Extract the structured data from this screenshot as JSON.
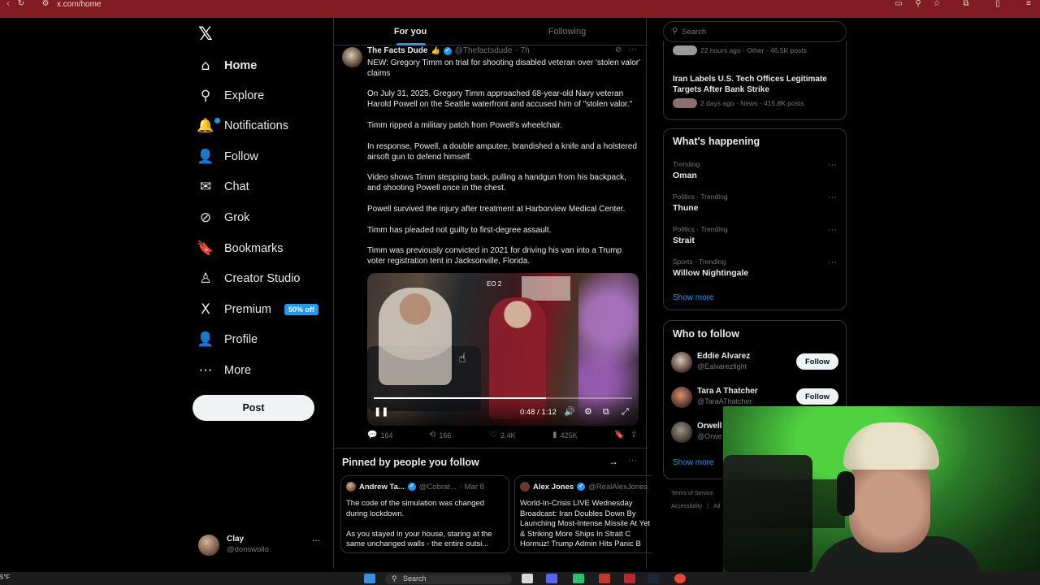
{
  "browser": {
    "url": "x.com/home",
    "accent": "#7f1d22"
  },
  "nav": {
    "items": [
      {
        "label": "Home",
        "icon": "home-icon",
        "glyph": "⌂"
      },
      {
        "label": "Explore",
        "icon": "search-icon",
        "glyph": "⚲"
      },
      {
        "label": "Notifications",
        "icon": "bell-icon",
        "glyph": "🔔"
      },
      {
        "label": "Follow",
        "icon": "follow-icon",
        "glyph": "👤"
      },
      {
        "label": "Chat",
        "icon": "mail-icon",
        "glyph": "✉"
      },
      {
        "label": "Grok",
        "icon": "grok-icon",
        "glyph": "⊘"
      },
      {
        "label": "Bookmarks",
        "icon": "bookmark-icon",
        "glyph": "🔖"
      },
      {
        "label": "Creator Studio",
        "icon": "creator-icon",
        "glyph": "♙"
      },
      {
        "label": "Premium",
        "icon": "x-icon",
        "glyph": "X"
      },
      {
        "label": "Profile",
        "icon": "profile-icon",
        "glyph": "👤"
      },
      {
        "label": "More",
        "icon": "more-icon",
        "glyph": "⋯"
      }
    ],
    "premium_badge": "50% off",
    "post_label": "Post",
    "account": {
      "name": "Clay",
      "handle": "@donswollo",
      "more": "···"
    }
  },
  "feed": {
    "tabs": [
      {
        "label": "For you"
      },
      {
        "label": "Following"
      }
    ],
    "tweet": {
      "author": "The Facts Dude",
      "handle": "@Thefactsdude",
      "time": "· 7h",
      "paragraphs": [
        "NEW: Gregory Timm on trial for shooting disabled veteran over 'stolen valor' claims",
        "On July 31, 2025, Gregory Timm approached 68-year-old Navy veteran Harold Powell on the Seattle waterfront and accused him of \"stolen valor.\"",
        "Timm ripped a military patch from Powell's wheelchair.",
        "In response, Powell, a double amputee, brandished a knife and a holstered airsoft gun to defend himself.",
        "Video shows Timm stepping back, pulling a handgun from his backpack, and shooting Powell once in the chest.",
        "Powell survived the injury after treatment at Harborview Medical Center.",
        "Timm has pleaded not guilty to first-degree assault.",
        "Timm was previously convicted in 2021 for driving his van into a Trump voter registration tent in Jacksonville, Florida."
      ],
      "video": {
        "label": "EO 2",
        "time": "0:48 / 1:12",
        "progress": 0.667
      },
      "stats": {
        "replies": "164",
        "reposts": "166",
        "likes": "2.4K",
        "views": "425K"
      }
    },
    "pinned": {
      "title": "Pinned by people you follow",
      "cards": [
        {
          "author": "Andrew Ta...",
          "handle": "@Cobrat...",
          "date": "· Mar 8",
          "text": "The code of the simulation was changed during lockdown.\n\nAs you stayed in your house, staring at the same unchanged walls - the entire outsi..."
        },
        {
          "author": "Alex Jones",
          "handle": "@RealAlexJones",
          "text": "World-In-Crisis LIVE Wednesday Broadcast: Iran Doubles Down By Launching Most-Intense Missile At Yet & Striking More Ships In Strait C Hormuz! Trump Admin Hits Panic B"
        }
      ]
    }
  },
  "sidebar": {
    "search_placeholder": "Search",
    "news": [
      {
        "meta": "22 hours ago · Other · 46.5K posts"
      },
      {
        "title": "Iran Labels U.S. Tech Offices Legitimate Targets After Bank Strike",
        "meta": "2 days ago · News · 415.8K posts"
      }
    ],
    "happening": {
      "title": "What's happening",
      "trends": [
        {
          "meta": "Trending",
          "name": "Oman"
        },
        {
          "meta": "Politics · Trending",
          "name": "Thune"
        },
        {
          "meta": "Politics · Trending",
          "name": "Strait"
        },
        {
          "meta": "Sports · Trending",
          "name": "Willow Nightingale"
        }
      ],
      "show_more": "Show more"
    },
    "who_to_follow": {
      "title": "Who to follow",
      "users": [
        {
          "name": "Eddie Alvarez",
          "handle": "@Ealvarezfight",
          "button": "Follow"
        },
        {
          "name": "Tara A Thatcher",
          "handle": "@TaraAThatcher",
          "button": "Follow"
        },
        {
          "name": "Orwell",
          "handle": "@Orwe"
        }
      ],
      "show_more": "Show more"
    },
    "footer": {
      "terms": "Terms of Service",
      "accessibility": "Accessibility",
      "ad": "Ad"
    }
  },
  "taskbar": {
    "search_label": "Search",
    "weather": "5°F"
  }
}
